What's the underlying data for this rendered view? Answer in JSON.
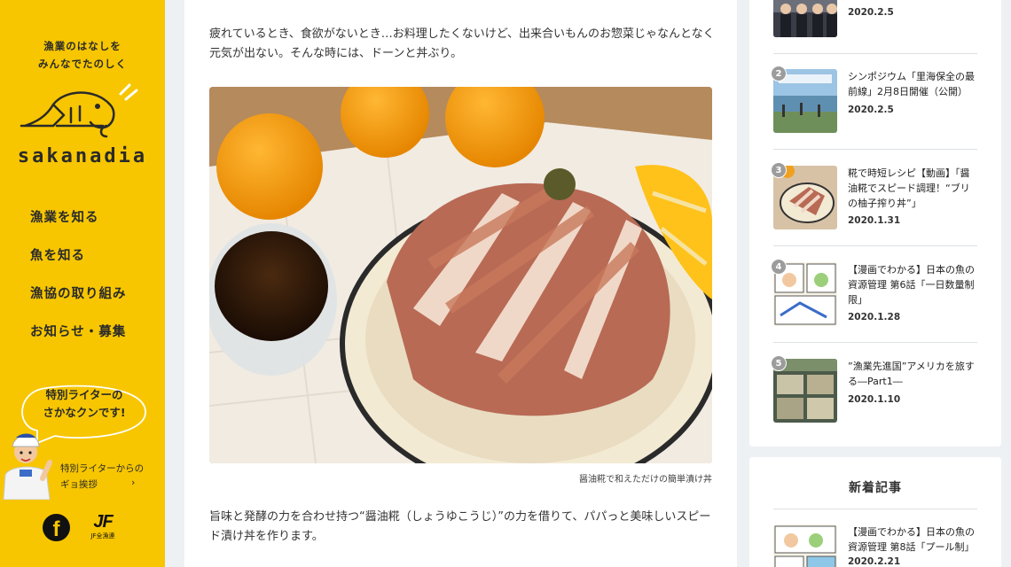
{
  "sidebar": {
    "tagline_line1": "漁業のはなしを",
    "tagline_line2": "みんなでたのしく",
    "logo_text": "sakanadia",
    "nav": [
      {
        "label": "漁業を知る"
      },
      {
        "label": "魚を知る"
      },
      {
        "label": "漁協の取り組み"
      },
      {
        "label": "お知らせ・募集"
      }
    ],
    "writer_title_line1": "特別ライターの",
    "writer_title_line2": "さかなクンです!",
    "writer_link_line1": "特別ライターからの",
    "writer_link_line2": "ギョ挨拶",
    "writer_chevron": "›",
    "facebook_glyph": "f",
    "jf_mark": "JF",
    "jf_name": "JF全漁連",
    "colors": {
      "brand_yellow": "#f7c600"
    }
  },
  "article": {
    "para1": "疲れているとき、食欲がないとき…お料理したくないけど、出来合いもんのお惣菜じゃなんとなく元気が出ない。そんな時には、ドーンと丼ぶり。",
    "caption": "醤油糀で和えただけの簡単漬け丼",
    "para2": "旨味と発酵の力を合わせ持つ“醤油糀（しょうゆこうじ）”の力を借りて、パパっと美味しいスピード漬け丼を作ります。"
  },
  "ranking": {
    "items": [
      {
        "num": "",
        "title": "",
        "date": "2020.2.5"
      },
      {
        "num": "2",
        "title": "シンポジウム「里海保全の最前線」2月8日開催（公開）",
        "date": "2020.2.5"
      },
      {
        "num": "3",
        "title": "糀で時短レシピ【動画】「醤油糀でスピード調理！“ブリの柚子搾り丼”」",
        "date": "2020.1.31"
      },
      {
        "num": "4",
        "title": "【漫画でわかる】日本の魚の資源管理 第6話「一日数量制限」",
        "date": "2020.1.28"
      },
      {
        "num": "5",
        "title": "”漁業先進国”アメリカを旅する―Part1―",
        "date": "2020.1.10"
      }
    ]
  },
  "new_articles": {
    "heading": "新着記事",
    "items": [
      {
        "title": "【漫画でわかる】日本の魚の資源管理 第8話「プール制」",
        "date": "2020.2.21"
      }
    ]
  }
}
